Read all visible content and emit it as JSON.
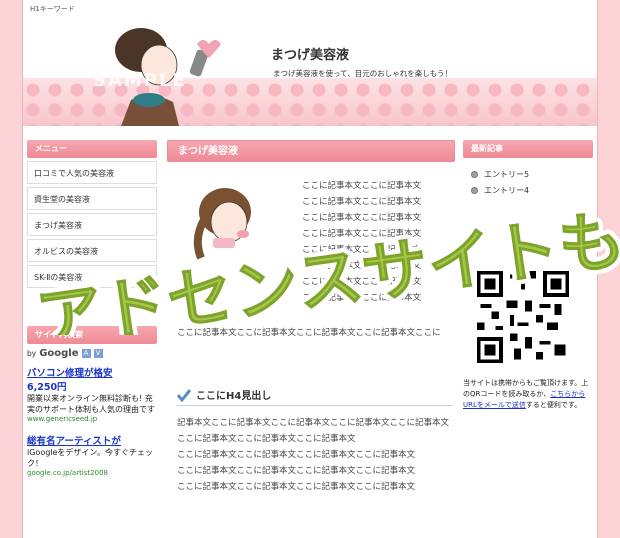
{
  "header": {
    "h1_keyword": "H1キーワード",
    "site_title": "まつげ美容液",
    "site_description": "まつげ美容液を使って、目元のおしゃれを楽しもう！",
    "watermark": "SAMPLE"
  },
  "menu": {
    "heading": "メニュー",
    "items": [
      {
        "label": "口コミで人気の美容液"
      },
      {
        "label": "資生堂の美容液"
      },
      {
        "label": "まつげ美容液"
      },
      {
        "label": "オルビスの美容液"
      },
      {
        "label": "SK-Ⅱの美容液"
      }
    ]
  },
  "search": {
    "heading": "サイト内検索",
    "powered": "by",
    "google": "Google"
  },
  "ads": [
    {
      "title": "パソコン修理が格安",
      "price": "6,250円",
      "text": "開業以来オンライン無料診断も! 充実のサポート体制も人気の理由です",
      "url": "www.genericseed.jp"
    },
    {
      "title": "総有名アーティストが",
      "text": "iGoogleをデザイン。今すぐチェック！",
      "url": "google.co.jp/artist2008"
    }
  ],
  "main": {
    "heading": "まつげ美容液",
    "side_lines": [
      "ここに記事本文ここに記事本文",
      "ここに記事本文ここに記事本文",
      "ここに記事本文ここに記事本文",
      "ここに記事本文ここに記事本文",
      "ここに記事本文ここに記事本文",
      "ここに記事本文ここに記事本文",
      "ここに記事本文ここに記事本文",
      "ここに記事本文ここに記事本文"
    ],
    "paragraph": "ここに記事本文ここに記事本文ここに記事本文ここに記事本文ここに",
    "h4": "ここにH4見出し",
    "body_lines": [
      "記事本文ここに記事本文ここに記事本文ここに記事本文ここに記事本文",
      "ここに記事本文ここに記事本文ここに記事本文",
      "ここに記事本文ここに記事本文ここに記事本文ここに記事本文",
      "ここに記事本文ここに記事本文ここに記事本文ここに記事本文",
      "ここに記事本文ここに記事本文ここに記事本文ここに記事本文"
    ]
  },
  "recent": {
    "heading": "最新記事",
    "entries": [
      {
        "label": "エントリー5"
      },
      {
        "label": "エントリー4"
      }
    ]
  },
  "qr": {
    "note_before": "当サイトは携帯からもご覧頂けます。上のQRコードを読み取るか、",
    "note_link": "こちらからURLをメールで送信",
    "note_after": "すると便利です。"
  },
  "overlay": {
    "text": "アドセンスサイトも…",
    "fill": "#a6c84a",
    "stroke": "#ffffff"
  },
  "colors": {
    "accent_pink": "#ee8a95",
    "background_pink": "#fbd3d6",
    "link_blue": "#1a34c8"
  }
}
